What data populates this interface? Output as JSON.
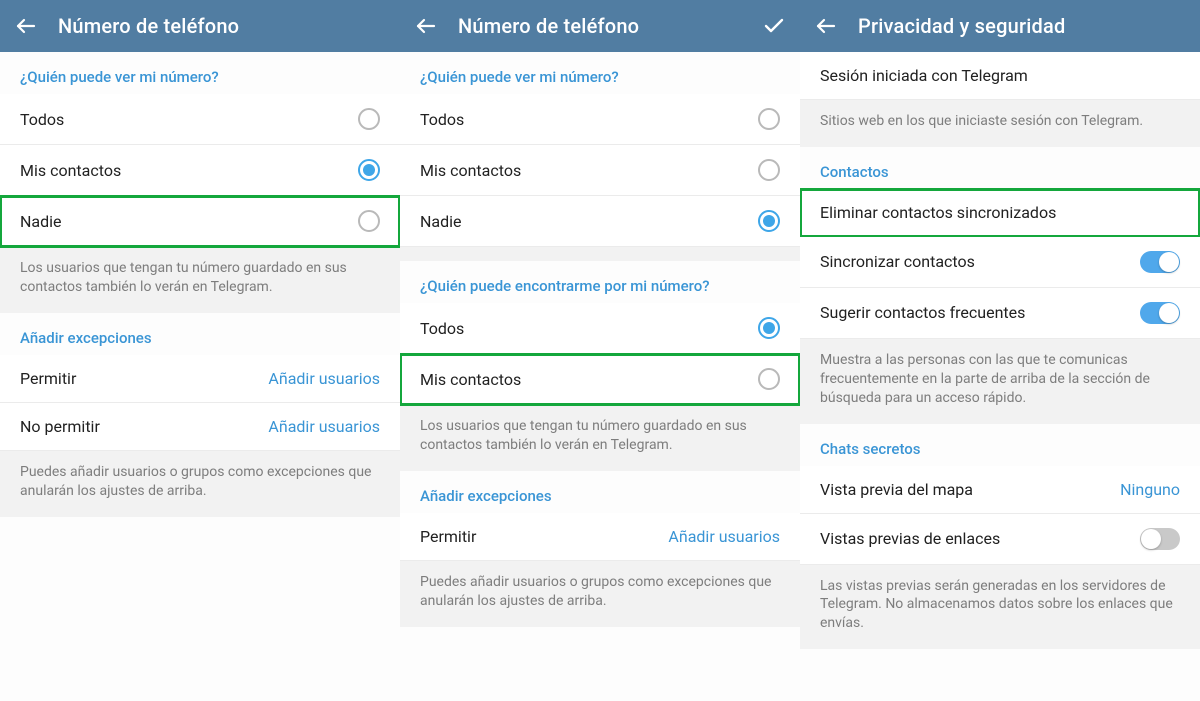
{
  "colors": {
    "header": "#517da2",
    "accent": "#3a95d5",
    "highlight": "#14a73c"
  },
  "screen1": {
    "title": "Número de teléfono",
    "q_who_see": "¿Quién puede ver mi número?",
    "opt_everyone": "Todos",
    "opt_contacts": "Mis contactos",
    "opt_nobody": "Nadie",
    "note_who_see": "Los usuarios que tengan tu número guardado en sus contactos también lo verán en Telegram.",
    "exceptions_header": "Añadir excepciones",
    "allow_label": "Permitir",
    "deny_label": "No permitir",
    "add_users": "Añadir usuarios",
    "exceptions_note": "Puedes añadir usuarios o grupos como excepciones que anularán los ajustes de arriba."
  },
  "screen2": {
    "title": "Número de teléfono",
    "q_who_see": "¿Quién puede ver mi número?",
    "opt_everyone": "Todos",
    "opt_contacts": "Mis contactos",
    "opt_nobody": "Nadie",
    "q_who_find": "¿Quién puede encontrarme por mi número?",
    "opt2_everyone": "Todos",
    "opt2_contacts": "Mis contactos",
    "note_who_see": "Los usuarios que tengan tu número guardado en sus contactos también lo verán en Telegram.",
    "exceptions_header": "Añadir excepciones",
    "allow_label": "Permitir",
    "add_users": "Añadir usuarios",
    "exceptions_note": "Puedes añadir usuarios o grupos como excepciones que anularán los ajustes de arriba."
  },
  "screen3": {
    "title": "Privacidad y seguridad",
    "session_row": "Sesión iniciada con Telegram",
    "session_note": "Sitios web en los que iniciaste sesión con Telegram.",
    "contacts_header": "Contactos",
    "delete_synced": "Eliminar contactos sincronizados",
    "sync_contacts": "Sincronizar contactos",
    "suggest_frequent": "Sugerir contactos frecuentes",
    "suggest_note": "Muestra a las personas con las que te comunicas frecuentemente en la parte de arriba de la sección de búsqueda para un acceso rápido.",
    "secret_header": "Chats secretos",
    "map_preview": "Vista previa del mapa",
    "map_preview_value": "Ninguno",
    "link_previews": "Vistas previas de enlaces",
    "link_previews_note": "Las vistas previas serán generadas en los servidores de Telegram. No almacenamos datos sobre los enlaces que envías."
  }
}
